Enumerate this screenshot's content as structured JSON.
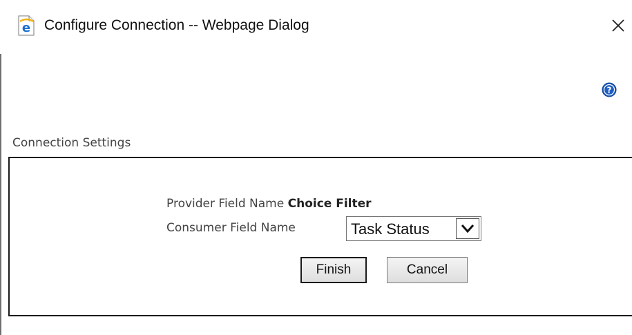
{
  "window": {
    "title": "Configure Connection -- Webpage Dialog",
    "icon": "internet-explorer-icon",
    "close_icon": "close-icon"
  },
  "help": {
    "icon": "help-icon",
    "color": "#1f5fbf"
  },
  "connection_settings": {
    "section_label": "Connection Settings",
    "provider_field_label": "Provider Field Name",
    "provider_field_value": "Choice Filter",
    "consumer_field_label": "Consumer Field Name",
    "consumer_field_selected": "Task Status",
    "finish_label": "Finish",
    "cancel_label": "Cancel"
  },
  "colors": {
    "ie_blue": "#1a6fd1",
    "ie_gold": "#f2b311",
    "panel_border": "#1a1a1a"
  }
}
